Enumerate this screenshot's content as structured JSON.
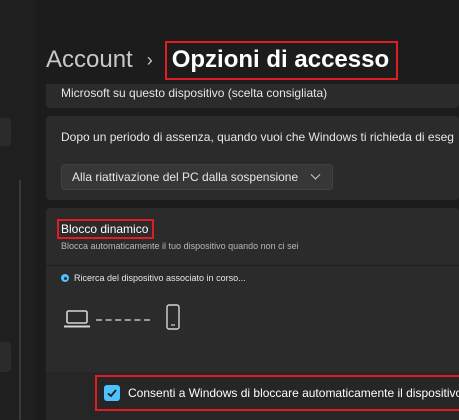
{
  "header": {
    "breadcrumb_root": "Account",
    "separator": "›",
    "title": "Opzioni di accesso"
  },
  "cards": {
    "top_text": "Microsoft su questo dispositivo (scelta consigliata)",
    "absence_text": "Dopo un periodo di assenza, quando vuoi che Windows ti richieda di eseg",
    "absence_dropdown_value": "Alla riattivazione del PC dalla sospensione"
  },
  "dynamic_lock": {
    "title": "Blocco dinamico",
    "description": "Blocca automaticamente il tuo dispositivo quando non ci sei",
    "status": "Ricerca del dispositivo associato in corso...",
    "checkbox_label": "Consenti a Windows di bloccare automaticamente il dispositivo",
    "checkbox_checked": true
  },
  "colors": {
    "accent": "#4cc2ff",
    "highlight": "#e01c24",
    "card": "#2b2b2b",
    "background": "#1c1c1c"
  },
  "icons": [
    "laptop-icon",
    "phone-icon",
    "chevron-down-icon",
    "checkmark-icon",
    "status-dot-icon"
  ]
}
